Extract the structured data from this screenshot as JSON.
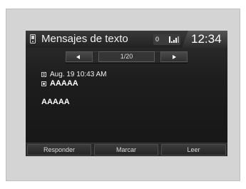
{
  "header": {
    "title": "Mensajes de texto",
    "status_text": "0",
    "clock": "12:34",
    "phone_icon": "phone-icon",
    "signal_icon": "signal-icon"
  },
  "nav": {
    "prev_icon": "triangle-left-icon",
    "next_icon": "triangle-right-icon",
    "page": "1/20"
  },
  "message": {
    "date": "Aug. 19 10:43 AM",
    "sender": "AAAAA",
    "body": "AAAAA",
    "date_icon": "envelope-icon",
    "sender_icon": "phone-icon"
  },
  "softkeys": [
    "Responder",
    "Marcar",
    "Leer"
  ],
  "colors": {
    "screen_bg": "#1d1d1d",
    "frame_bg": "#d4d4d4",
    "text": "#f2f2f2"
  }
}
